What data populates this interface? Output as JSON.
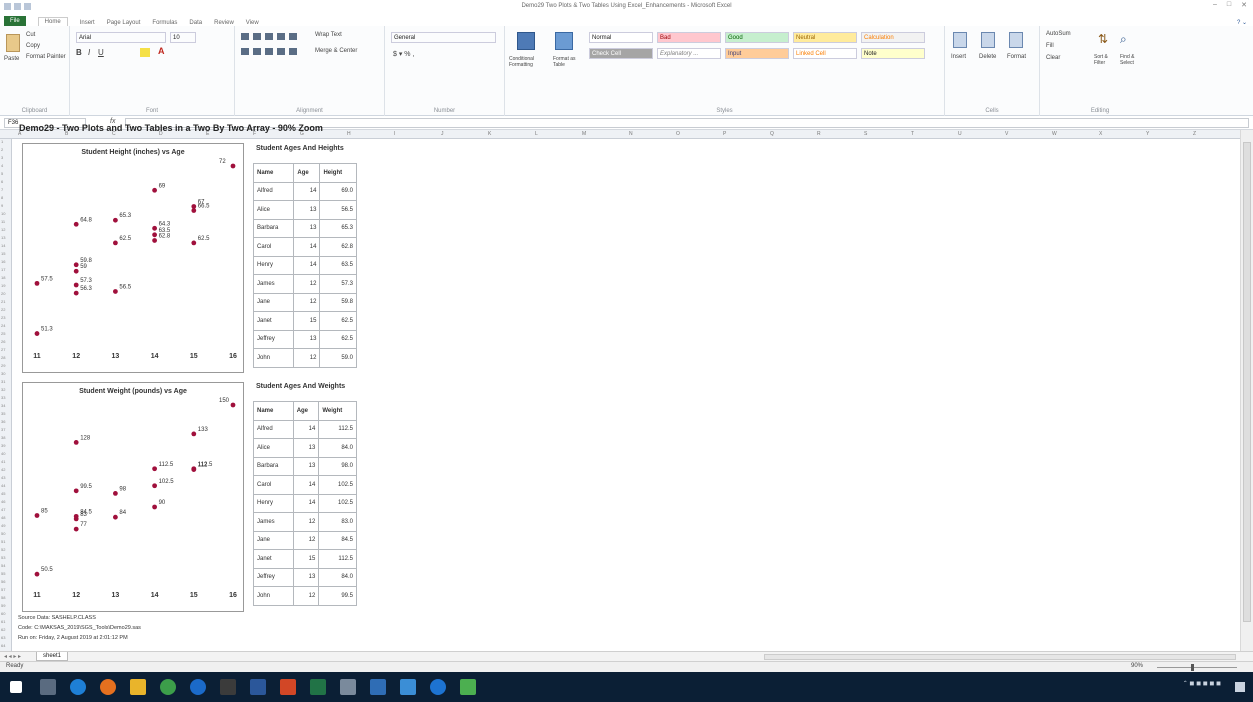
{
  "app": {
    "window_title": "Demo29 Two Plots & Two Tables Using Excel_Enhancements - Microsoft Excel",
    "tabs": [
      "File",
      "Home",
      "Insert",
      "Page Layout",
      "Formulas",
      "Data",
      "Review",
      "View"
    ],
    "name_box": "F36"
  },
  "ribbon": {
    "clipboard": {
      "paste": "Paste",
      "cut": "Cut",
      "copy": "Copy",
      "format_painter": "Format Painter",
      "label": "Clipboard"
    },
    "font": {
      "name": "Arial",
      "size": "10",
      "label": "Font"
    },
    "alignment": {
      "wrap": "Wrap Text",
      "merge": "Merge & Center",
      "label": "Alignment"
    },
    "number": {
      "format": "General",
      "label": "Number"
    },
    "styles": {
      "cond": "Conditional Formatting",
      "table": "Format as Table",
      "normal": "Normal",
      "bad": "Bad",
      "good": "Good",
      "neutral": "Neutral",
      "calculation": "Calculation",
      "check_cell": "Check Cell",
      "explanatory": "Explanatory ...",
      "input": "Input",
      "linked_cell": "Linked Cell",
      "note": "Note",
      "label": "Styles"
    },
    "cells": {
      "insert": "Insert",
      "delete": "Delete",
      "format": "Format",
      "label": "Cells"
    },
    "editing": {
      "autosum": "AutoSum",
      "fill": "Fill",
      "clear": "Clear",
      "sort": "Sort & Filter",
      "find": "Find & Select",
      "label": "Editing"
    }
  },
  "sheet": {
    "main_title": "Demo29 - Two Plots and Two Tables in a Two By Two Array - 90% Zoom",
    "footer": [
      "Source Data: SASHELP.CLASS",
      "Code: C:\\MAKSAS_2019\\SGS_Tools\\Demo29.sas",
      "Run on: Friday, 2 August 2019 at 2:01:12 PM"
    ],
    "sheet_tab": "sheet1",
    "status": "Ready",
    "zoom": "90%"
  },
  "table1": {
    "title": "Student Ages And Heights",
    "headers": [
      "Name",
      "Age",
      "Height"
    ],
    "rows": [
      [
        "Alfred",
        "14",
        "69.0"
      ],
      [
        "Alice",
        "13",
        "56.5"
      ],
      [
        "Barbara",
        "13",
        "65.3"
      ],
      [
        "Carol",
        "14",
        "62.8"
      ],
      [
        "Henry",
        "14",
        "63.5"
      ],
      [
        "James",
        "12",
        "57.3"
      ],
      [
        "Jane",
        "12",
        "59.8"
      ],
      [
        "Janet",
        "15",
        "62.5"
      ],
      [
        "Jeffrey",
        "13",
        "62.5"
      ],
      [
        "John",
        "12",
        "59.0"
      ]
    ]
  },
  "table2": {
    "title": "Student Ages And Weights",
    "headers": [
      "Name",
      "Age",
      "Weight"
    ],
    "rows": [
      [
        "Alfred",
        "14",
        "112.5"
      ],
      [
        "Alice",
        "13",
        "84.0"
      ],
      [
        "Barbara",
        "13",
        "98.0"
      ],
      [
        "Carol",
        "14",
        "102.5"
      ],
      [
        "Henry",
        "14",
        "102.5"
      ],
      [
        "James",
        "12",
        "83.0"
      ],
      [
        "Jane",
        "12",
        "84.5"
      ],
      [
        "Janet",
        "15",
        "112.5"
      ],
      [
        "Jeffrey",
        "13",
        "84.0"
      ],
      [
        "John",
        "12",
        "99.5"
      ]
    ]
  },
  "chart_data": [
    {
      "type": "scatter",
      "title": "Student Height (inches) vs Age",
      "xlabel": "",
      "ylabel": "",
      "x_ticks": [
        11,
        12,
        13,
        14,
        15,
        16
      ],
      "xlim": [
        11,
        16
      ],
      "ylim": [
        51,
        72
      ],
      "marker_color": "#a0103c",
      "points": [
        {
          "x": 11,
          "y": 51.3,
          "label": "51.3"
        },
        {
          "x": 11,
          "y": 57.5,
          "label": "57.5"
        },
        {
          "x": 12,
          "y": 56.3,
          "label": "56.3"
        },
        {
          "x": 12,
          "y": 57.3,
          "label": "57.3"
        },
        {
          "x": 12,
          "y": 59.0,
          "label": "59"
        },
        {
          "x": 12,
          "y": 59.8,
          "label": "59.8"
        },
        {
          "x": 12,
          "y": 64.8,
          "label": "64.8"
        },
        {
          "x": 13,
          "y": 56.5,
          "label": "56.5"
        },
        {
          "x": 13,
          "y": 62.5,
          "label": "62.5"
        },
        {
          "x": 13,
          "y": 65.3,
          "label": "65.3"
        },
        {
          "x": 14,
          "y": 62.8,
          "label": "62.8"
        },
        {
          "x": 14,
          "y": 63.5,
          "label": "63.5"
        },
        {
          "x": 14,
          "y": 64.3,
          "label": "64.3"
        },
        {
          "x": 14,
          "y": 69.0,
          "label": "69"
        },
        {
          "x": 15,
          "y": 62.5,
          "label": "62.5"
        },
        {
          "x": 15,
          "y": 66.5,
          "label": "66.5"
        },
        {
          "x": 15,
          "y": 67.0,
          "label": "67"
        },
        {
          "x": 16,
          "y": 72.0,
          "label": "72"
        }
      ]
    },
    {
      "type": "scatter",
      "title": "Student Weight (pounds) vs Age",
      "xlabel": "",
      "ylabel": "",
      "x_ticks": [
        11,
        12,
        13,
        14,
        15,
        16
      ],
      "xlim": [
        11,
        16
      ],
      "ylim": [
        50,
        150
      ],
      "marker_color": "#a0103c",
      "points": [
        {
          "x": 11,
          "y": 50.5,
          "label": "50.5"
        },
        {
          "x": 11,
          "y": 85.0,
          "label": "85"
        },
        {
          "x": 12,
          "y": 77.0,
          "label": "77"
        },
        {
          "x": 12,
          "y": 83.0,
          "label": "83"
        },
        {
          "x": 12,
          "y": 84.5,
          "label": "84.5"
        },
        {
          "x": 12,
          "y": 99.5,
          "label": "99.5"
        },
        {
          "x": 12,
          "y": 128.0,
          "label": "128"
        },
        {
          "x": 13,
          "y": 84.0,
          "label": "84"
        },
        {
          "x": 13,
          "y": 98.0,
          "label": "98"
        },
        {
          "x": 14,
          "y": 90.0,
          "label": "90"
        },
        {
          "x": 14,
          "y": 102.5,
          "label": "102.5"
        },
        {
          "x": 14,
          "y": 112.5,
          "label": "112.5"
        },
        {
          "x": 15,
          "y": 112.0,
          "label": "112"
        },
        {
          "x": 15,
          "y": 112.5,
          "label": "112.5"
        },
        {
          "x": 15,
          "y": 133.0,
          "label": "133"
        },
        {
          "x": 16,
          "y": 150.0,
          "label": "150"
        }
      ]
    }
  ]
}
